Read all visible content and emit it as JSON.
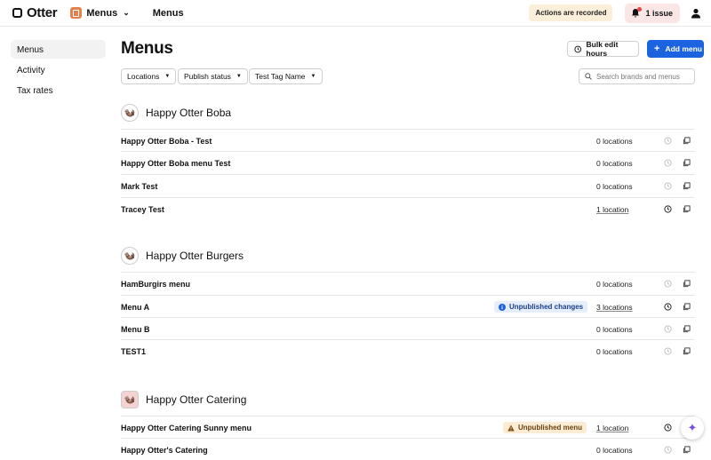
{
  "topbar": {
    "logo": "Otter",
    "app_name": "Menus",
    "page_title": "Menus",
    "recorded_badge": "Actions are recorded",
    "issue_label": "1 issue"
  },
  "sidebar": {
    "items": [
      {
        "label": "Menus",
        "active": true
      },
      {
        "label": "Activity",
        "active": false
      },
      {
        "label": "Tax rates",
        "active": false
      }
    ]
  },
  "main": {
    "title": "Menus",
    "bulk_edit_label": "Bulk edit hours",
    "add_menu_label": "Add menu",
    "filters": [
      "Locations",
      "Publish status",
      "Test Tag Name"
    ],
    "search_placeholder": "Search brands and menus"
  },
  "brands": [
    {
      "name": "Happy Otter Boba",
      "menus": [
        {
          "name": "Happy Otter Boba - Test",
          "locations": "0 locations"
        },
        {
          "name": "Happy Otter Boba menu Test",
          "locations": "0 locations"
        },
        {
          "name": "Mark Test",
          "locations": "0 locations"
        },
        {
          "name": "Tracey Test",
          "locations": "1 location"
        }
      ]
    },
    {
      "name": "Happy Otter Burgers",
      "menus": [
        {
          "name": "HamBurgirs menu",
          "locations": "0 locations"
        },
        {
          "name": "Menu A",
          "locations": "3 locations",
          "badge": "Unpublished changes"
        },
        {
          "name": "Menu B",
          "locations": "0 locations"
        },
        {
          "name": "TEST1",
          "locations": "0 locations"
        }
      ]
    },
    {
      "name": "Happy Otter Catering",
      "menus": [
        {
          "name": "Happy Otter Catering Sunny menu",
          "locations": "1 location",
          "badge": "Unpublished menu"
        },
        {
          "name": "Happy Otter's Catering",
          "locations": "0 locations"
        }
      ]
    }
  ],
  "colors": {
    "primary": "#1c63e0",
    "issue_bg": "#fbe6e6",
    "recorded_bg": "#fcefd9",
    "badge_blue_bg": "#e6eefc",
    "badge_orange_bg": "#fcecd3"
  },
  "icons": [
    "otter-logo-icon",
    "menus-app-icon",
    "chevron-down-icon",
    "bell-icon",
    "user-icon",
    "clock-icon",
    "plus-icon",
    "search-icon",
    "copy-icon",
    "info-icon",
    "warning-icon",
    "sparkle-icon"
  ]
}
